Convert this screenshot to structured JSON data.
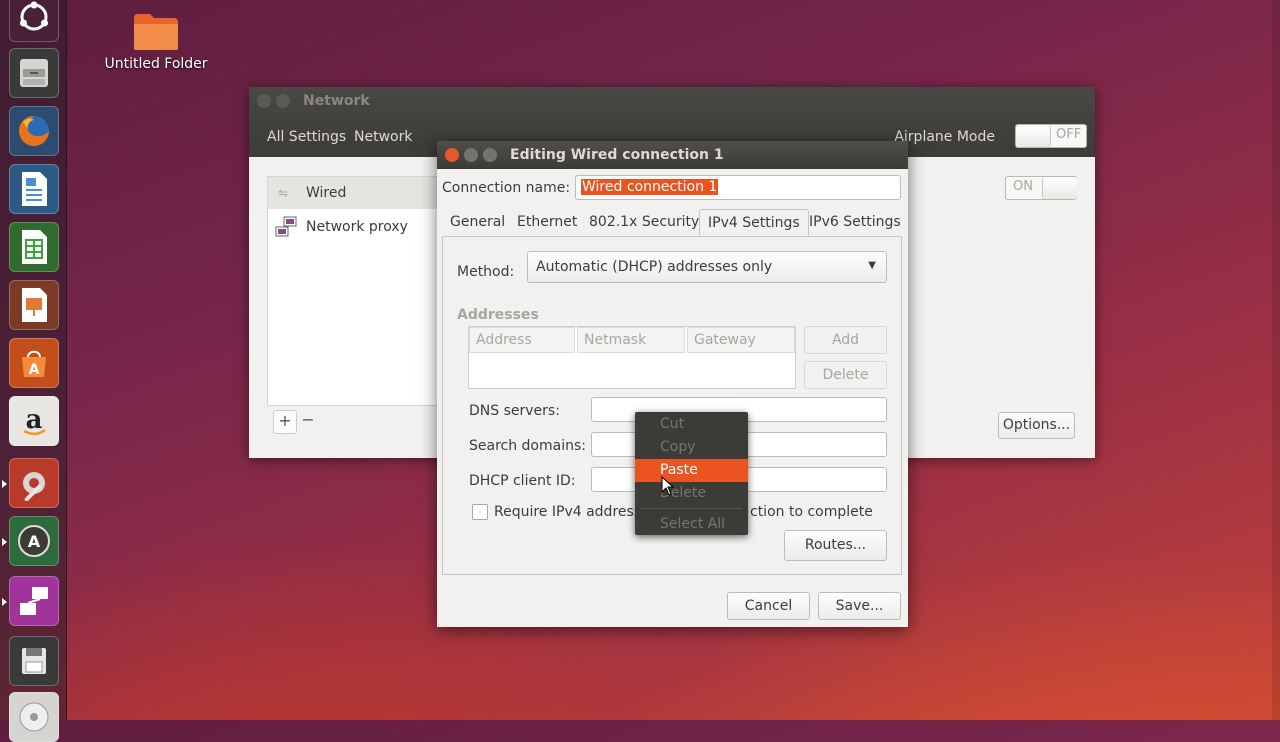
{
  "desktop": {
    "folder_label": "Untitled Folder"
  },
  "launcher": {
    "items": [
      "ubuntu-dash",
      "files",
      "firefox",
      "libreoffice-writer",
      "libreoffice-calc",
      "libreoffice-impress",
      "ubuntu-software-center",
      "amazon",
      "system-settings",
      "software-updater",
      "network-settings",
      "disk-save",
      "dvd"
    ]
  },
  "network_window": {
    "title": "Network",
    "nav": {
      "all_settings": "All Settings",
      "network": "Network"
    },
    "airplane_mode_label": "Airplane Mode",
    "airplane_toggle": "OFF",
    "wired_toggle": "ON",
    "sidebar": [
      {
        "label": "Wired",
        "icon": "wired-icon"
      },
      {
        "label": "Network proxy",
        "icon": "network-proxy-icon"
      }
    ],
    "add_label": "+",
    "remove_label": "−",
    "options_label": "Options..."
  },
  "dialog": {
    "title": "Editing Wired connection 1",
    "connection_name_label": "Connection name:",
    "connection_name_value": "Wired connection 1",
    "tabs": [
      "General",
      "Ethernet",
      "802.1x Security",
      "IPv4 Settings",
      "IPv6 Settings"
    ],
    "active_tab": "IPv4 Settings",
    "method_label": "Method:",
    "method_value": "Automatic (DHCP) addresses only",
    "addresses_label": "Addresses",
    "address_columns": [
      "Address",
      "Netmask",
      "Gateway"
    ],
    "add_label": "Add",
    "delete_label": "Delete",
    "dns_label": "DNS servers:",
    "search_label": "Search domains:",
    "dhcp_label": "DHCP client ID:",
    "require_label_left": "Require IPv4 addressi",
    "require_label_right": "ction to complete",
    "routes_label": "Routes...",
    "cancel_label": "Cancel",
    "save_label": "Save..."
  },
  "context_menu": {
    "items": [
      "Cut",
      "Copy",
      "Paste",
      "Delete",
      "Select All"
    ],
    "highlighted": "Paste"
  },
  "colors": {
    "accent": "#e95420",
    "titlebar": "#3c3b37",
    "window_bg": "#f2f1f0"
  }
}
